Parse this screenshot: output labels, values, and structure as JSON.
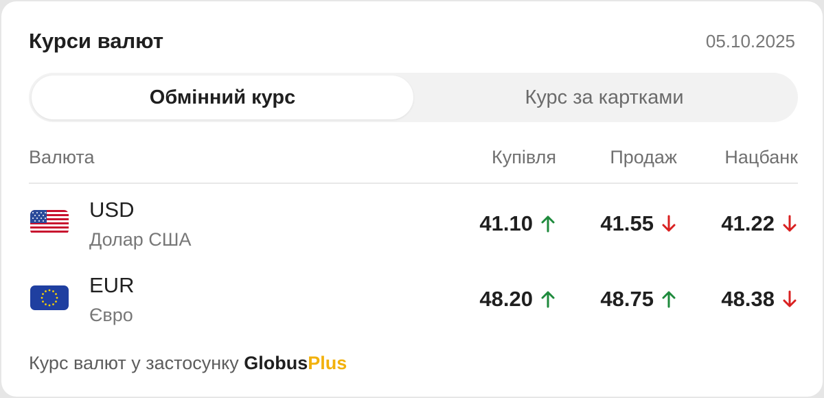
{
  "header": {
    "title": "Курси валют",
    "date": "05.10.2025"
  },
  "tabs": [
    {
      "label": "Обмінний курс",
      "active": true
    },
    {
      "label": "Курс за картками",
      "active": false
    }
  ],
  "table": {
    "columns": [
      "Валюта",
      "Купівля",
      "Продаж",
      "Нацбанк"
    ],
    "rows": [
      {
        "code": "USD",
        "name": "Долар США",
        "flag_icon": "us-flag-icon",
        "buy": "41.10",
        "buy_trend": "up",
        "sell": "41.55",
        "sell_trend": "down",
        "nbu": "41.22",
        "nbu_trend": "down"
      },
      {
        "code": "EUR",
        "name": "Євро",
        "flag_icon": "eu-flag-icon",
        "buy": "48.20",
        "buy_trend": "up",
        "sell": "48.75",
        "sell_trend": "up",
        "nbu": "48.38",
        "nbu_trend": "down"
      }
    ]
  },
  "footer": {
    "text": "Курс валют у застосунку ",
    "brand_part1": "Globus",
    "brand_part2": "Plus"
  },
  "colors": {
    "up": "#1e8a3c",
    "down": "#d92020",
    "brand_accent": "#f2b10c"
  }
}
